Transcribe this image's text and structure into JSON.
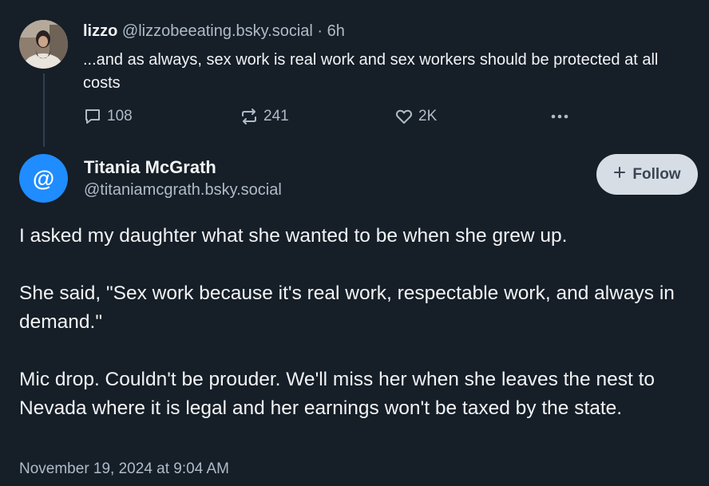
{
  "parent_post": {
    "display_name": "lizzo",
    "handle": "@lizzobeeating.bsky.social",
    "separator": " · ",
    "age": "6h",
    "text": "...and as always, sex work is real work and sex workers should be protected at all costs",
    "stats": {
      "replies": "108",
      "reposts": "241",
      "likes": "2K"
    },
    "icons": {
      "reply": "speech-bubble-icon",
      "repost": "repost-arrows-icon",
      "like": "heart-icon",
      "more": "ellipsis-icon"
    }
  },
  "main_post": {
    "display_name": "Titania McGrath",
    "handle": "@titaniamcgrath.bsky.social",
    "avatar_glyph": "@",
    "follow_label": "Follow",
    "paragraphs": [
      "I asked my daughter what she wanted to be when she grew up.",
      "She said, \"Sex work because it's real work, respectable work, and always in demand.\"",
      "Mic drop. Couldn't be prouder. We'll miss her when she leaves the nest to Nevada where it is legal and her earnings won't be taxed by the state."
    ],
    "timestamp": "November 19, 2024 at 9:04 AM"
  },
  "colors": {
    "background": "#161e27",
    "text": "#f1f3f5",
    "muted": "#aebbc9",
    "avatar_blue": "#1f8cff",
    "thread_line": "#2e4052",
    "follow_bg": "#d7dde4"
  }
}
